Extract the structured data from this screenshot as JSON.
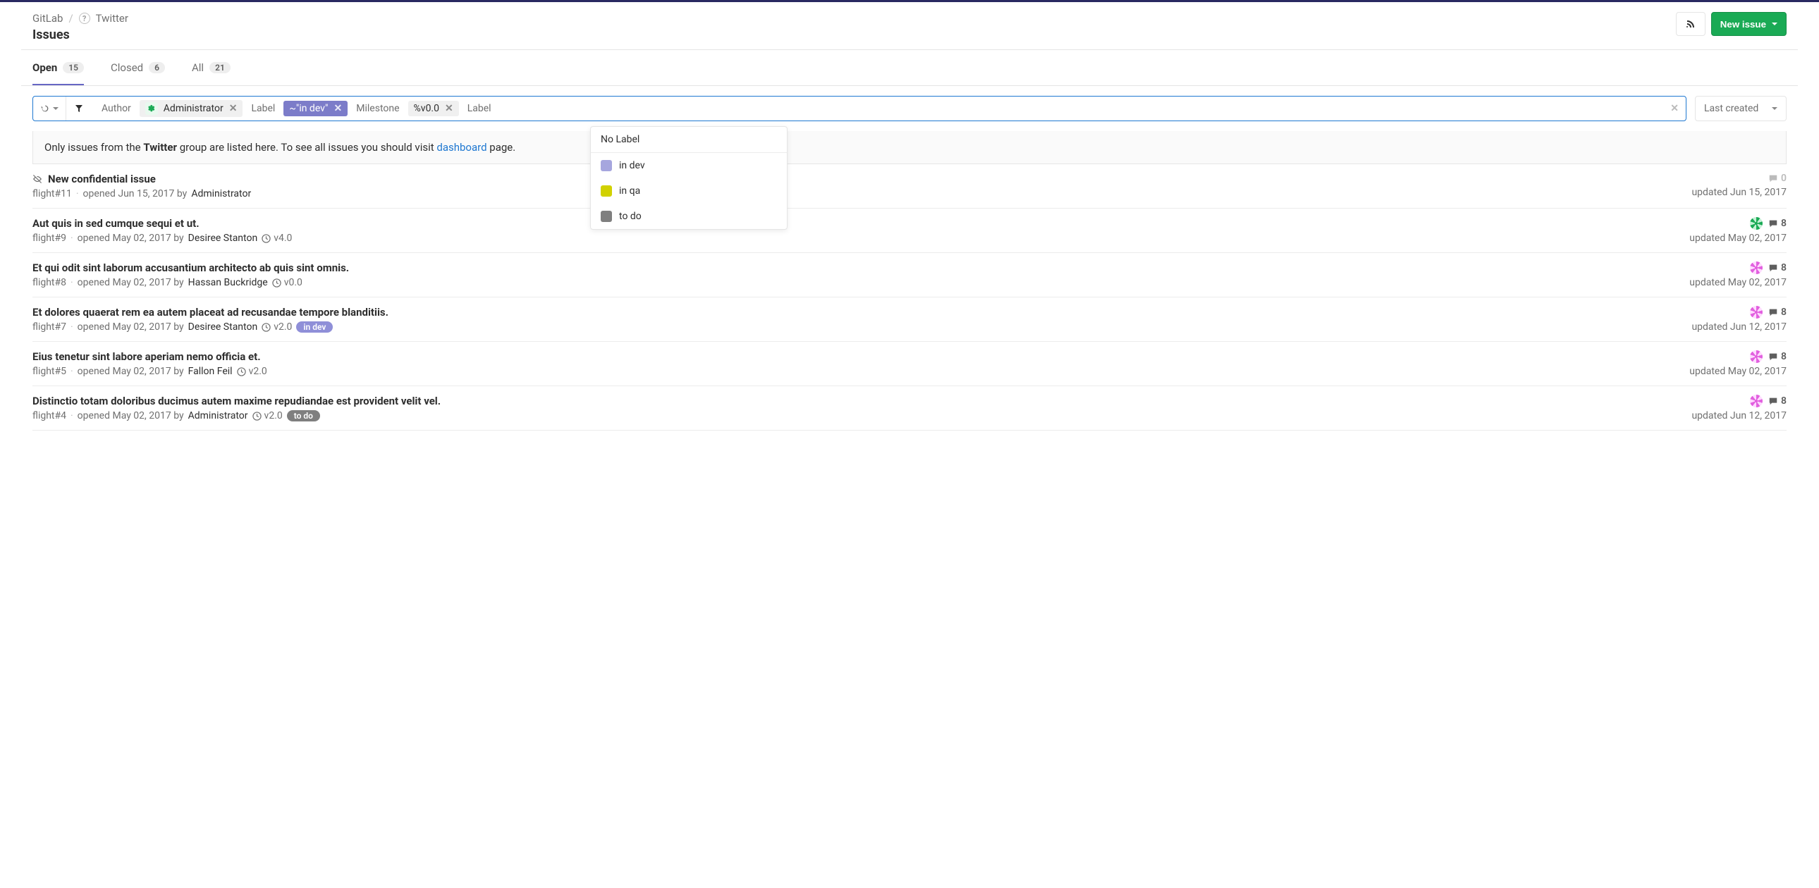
{
  "breadcrumbs": {
    "root": "GitLab",
    "group": "Twitter"
  },
  "page_title": "Issues",
  "top_actions": {
    "new_issue": "New issue"
  },
  "tabs": {
    "open": {
      "label": "Open",
      "count": "15"
    },
    "closed": {
      "label": "Closed",
      "count": "6"
    },
    "all": {
      "label": "All",
      "count": "21"
    }
  },
  "filter": {
    "author_label": "Author",
    "author_value": "Administrator",
    "label_label": "Label",
    "label_value": "~\"in dev\"",
    "milestone_label": "Milestone",
    "milestone_value": "%v0.0",
    "label2_label": "Label"
  },
  "sort": {
    "label": "Last created"
  },
  "label_dropdown": {
    "no_label": "No Label",
    "items": [
      {
        "name": "in dev",
        "color": "#a6a6de"
      },
      {
        "name": "in qa",
        "color": "#d1d100"
      },
      {
        "name": "to do",
        "color": "#7f7f7f"
      }
    ]
  },
  "banner": {
    "prefix": "Only issues from the ",
    "group": "Twitter",
    "middle": " group are listed here. To see all issues you should visit ",
    "link": "dashboard",
    "suffix": " page."
  },
  "issues": [
    {
      "confidential": true,
      "title": "New confidential issue",
      "ref": "flight#11",
      "opened": "opened Jun 15, 2017 by",
      "author": "Administrator",
      "milestone": null,
      "labels": [],
      "assignee": null,
      "comments": "0",
      "comments_muted": true,
      "updated": "updated Jun 15, 2017"
    },
    {
      "confidential": false,
      "title": "Aut quis in sed cumque sequi et ut.",
      "ref": "flight#9",
      "opened": "opened May 02, 2017 by",
      "author": "Desiree Stanton",
      "milestone": "v4.0",
      "labels": [],
      "assignee": "green",
      "comments": "8",
      "comments_muted": false,
      "updated": "updated May 02, 2017"
    },
    {
      "confidential": false,
      "title": "Et qui odit sint laborum accusantium architecto ab quis sint omnis.",
      "ref": "flight#8",
      "opened": "opened May 02, 2017 by",
      "author": "Hassan Buckridge",
      "milestone": "v0.0",
      "labels": [],
      "assignee": "blue",
      "comments": "8",
      "comments_muted": false,
      "updated": "updated May 02, 2017"
    },
    {
      "confidential": false,
      "title": "Et dolores quaerat rem ea autem placeat ad recusandae tempore blanditiis.",
      "ref": "flight#7",
      "opened": "opened May 02, 2017 by",
      "author": "Desiree Stanton",
      "milestone": "v2.0",
      "labels": [
        {
          "text": "in dev",
          "bg": "#8f8fd8"
        }
      ],
      "assignee": "blue",
      "comments": "8",
      "comments_muted": false,
      "updated": "updated Jun 12, 2017"
    },
    {
      "confidential": false,
      "title": "Eius tenetur sint labore aperiam nemo officia et.",
      "ref": "flight#5",
      "opened": "opened May 02, 2017 by",
      "author": "Fallon Feil",
      "milestone": "v2.0",
      "labels": [],
      "assignee": "blue",
      "comments": "8",
      "comments_muted": false,
      "updated": "updated May 02, 2017"
    },
    {
      "confidential": false,
      "title": "Distinctio totam doloribus ducimus autem maxime repudiandae est provident velit vel.",
      "ref": "flight#4",
      "opened": "opened May 02, 2017 by",
      "author": "Administrator",
      "milestone": "v2.0",
      "labels": [
        {
          "text": "to do",
          "bg": "#7f7f7f"
        }
      ],
      "assignee": "blue",
      "comments": "8",
      "comments_muted": false,
      "updated": "updated Jun 12, 2017"
    }
  ]
}
